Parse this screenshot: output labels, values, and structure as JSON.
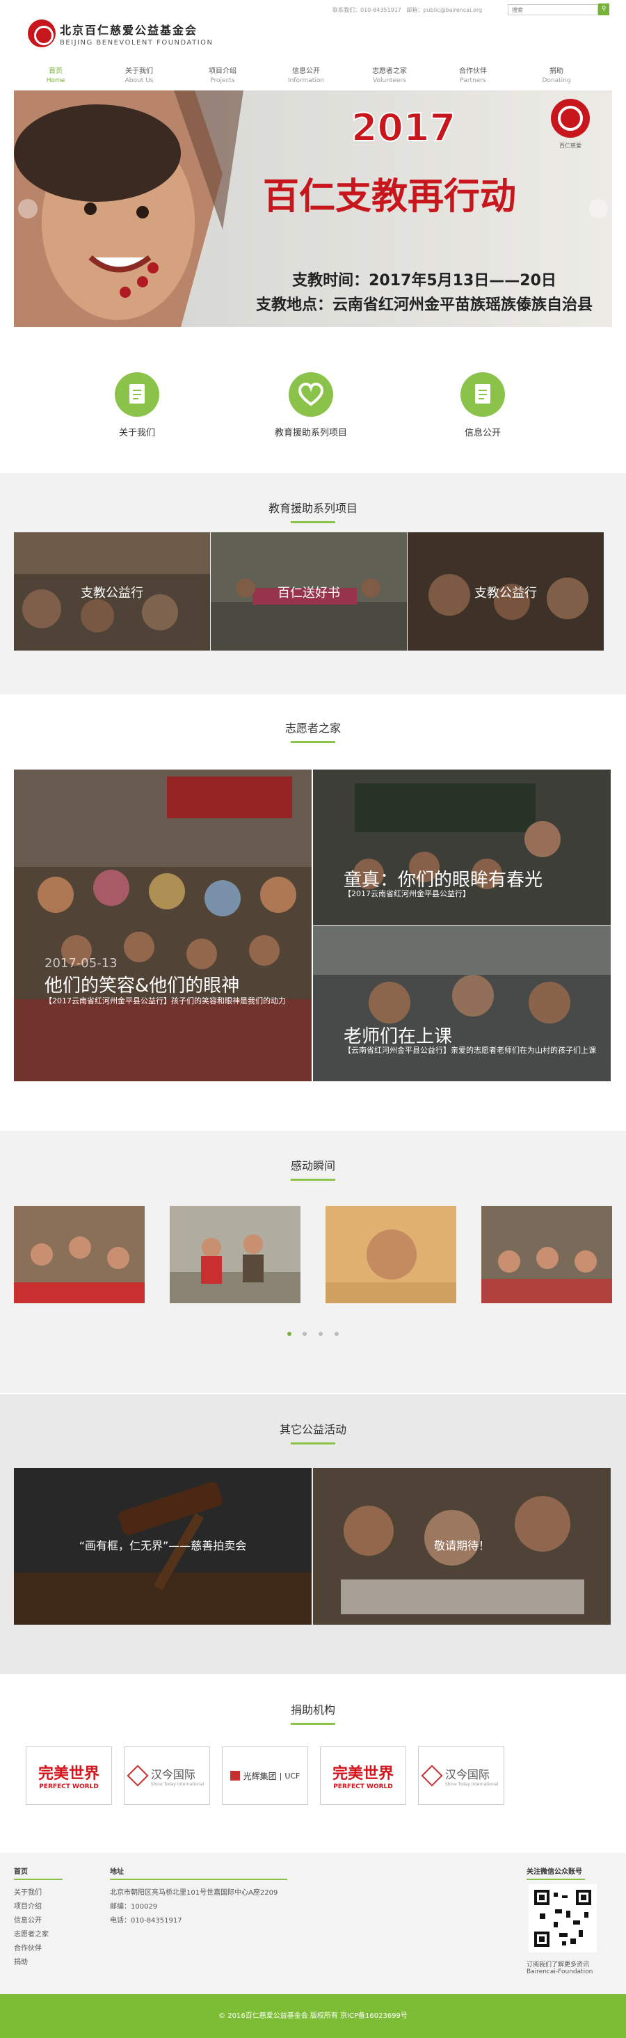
{
  "top": {
    "phone_label": "联系我们：010-84351917",
    "email_label": "邮箱：public@bairencai.org",
    "search_placeholder": "搜索",
    "search_icon": "search-icon"
  },
  "brand": {
    "name_cn": "北京百仁慈爱公益基金会",
    "name_en": "BEIJING BENEVOLENT FOUNDATION",
    "accent": "#76b23a",
    "logo_red": "#c8161d"
  },
  "nav": [
    {
      "cn": "首页",
      "en": "Home"
    },
    {
      "cn": "关于我们",
      "en": "About Us"
    },
    {
      "cn": "项目介绍",
      "en": "Projects"
    },
    {
      "cn": "信息公开",
      "en": "Information"
    },
    {
      "cn": "志愿者之家",
      "en": "Volunteers"
    },
    {
      "cn": "合作伙伴",
      "en": "Partners"
    },
    {
      "cn": "捐助",
      "en": "Donating"
    }
  ],
  "banner": {
    "year": "2017",
    "title": "百仁支教再行动",
    "time": "支教时间：2017年5月13日——20日",
    "place": "支教地点：云南省红河州金平苗族瑶族傣族自治县",
    "badge": "百仁慈爱"
  },
  "quick_links": [
    {
      "label": "关于我们",
      "icon": "document-icon"
    },
    {
      "label": "教育援助系列项目",
      "icon": "heart-icon"
    },
    {
      "label": "信息公开",
      "icon": "document-icon"
    }
  ],
  "edu": {
    "title": "教育援助系列项目",
    "items": [
      "支教公益行",
      "百仁送好书",
      "支教公益行"
    ]
  },
  "volunteers": {
    "title": "志愿者之家",
    "left": {
      "date": "2017-05-13",
      "title": "他们的笑容&他们的眼神",
      "desc": "【2017云南省红河州金平县公益行】孩子们的笑容和眼神是我们的动力"
    },
    "right_top": {
      "title": "童真：你们的眼眸有春光",
      "desc": "【2017云南省红河州金平县公益行】"
    },
    "right_bottom": {
      "title": "老师们在上课",
      "desc": "【云南省红河州金平县公益行】亲爱的志愿者老师们在为山村的孩子们上课"
    }
  },
  "moments": {
    "title": "感动瞬间"
  },
  "other": {
    "title": "其它公益活动",
    "items": [
      "“画有框，仁无界”——慈善拍卖会",
      "敬请期待！"
    ]
  },
  "sponsors": {
    "title": "捐助机构",
    "items": [
      {
        "cn": "完美世界",
        "en": "PERFECT WORLD"
      },
      {
        "cn": "汉今国际",
        "en": "Shine Today International"
      },
      {
        "cn": "光辉集团",
        "en": "UCF"
      },
      {
        "cn": "完美世界",
        "en": "PERFECT WORLD"
      },
      {
        "cn": "汉今国际",
        "en": "Shine Today International"
      }
    ]
  },
  "footer": {
    "col1_title": "首页",
    "col1_items": [
      "关于我们",
      "项目介绍",
      "信息公开",
      "志愿者之家",
      "合作伙伴",
      "捐助"
    ],
    "col2_title": "地址",
    "address": "北京市朝阳区亮马桥北里101号世嘉国际中心A座2209",
    "postcode": "邮编：100029",
    "phone": "电话：010-84351917",
    "wechat_title": "关注微信公众账号",
    "wechat_desc1": "订阅我们了解更多资讯",
    "wechat_desc2": "Bairencai-Foundation"
  },
  "copyright": "© 2016百仁慈爱公益基金会 版权所有 京ICP备16023699号"
}
